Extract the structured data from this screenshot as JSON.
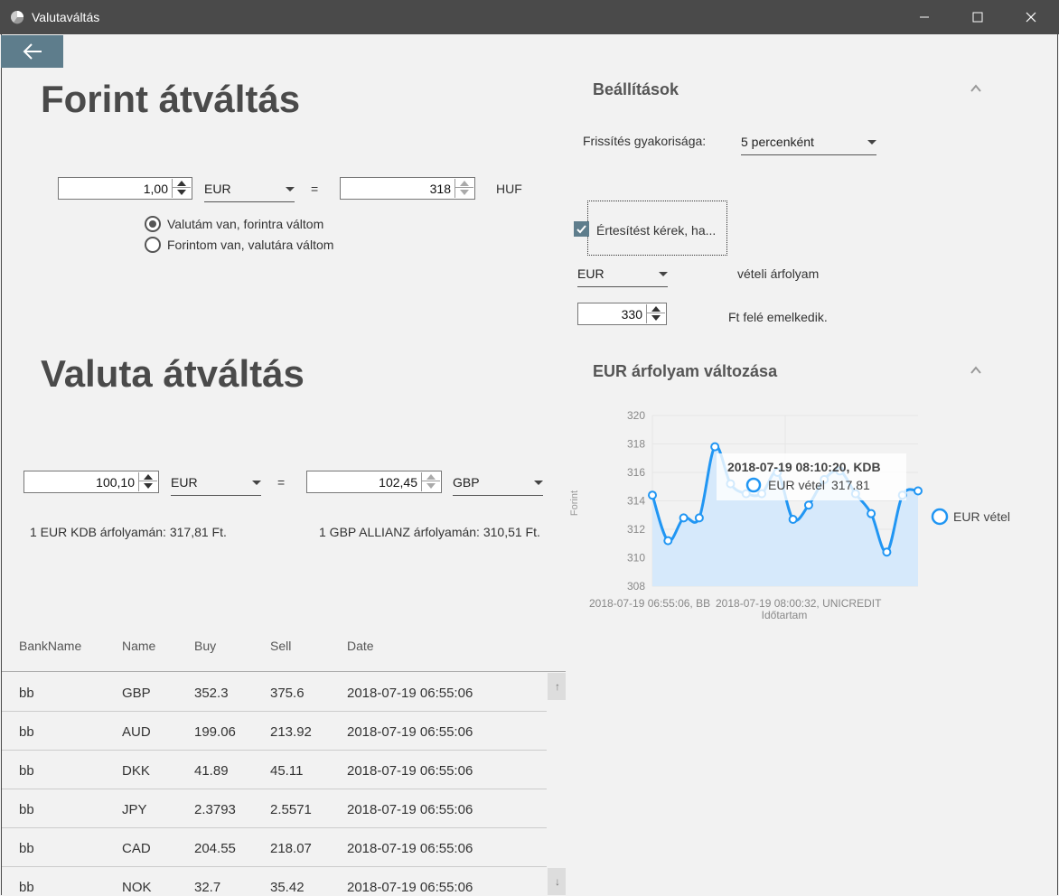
{
  "window": {
    "title": "Valutaváltás"
  },
  "forint": {
    "heading": "Forint átváltás",
    "amount": "1,00",
    "currency": "EUR",
    "equals": "=",
    "result": "318",
    "target_currency": "HUF",
    "radio_options": [
      "Valutám van, forintra váltom",
      "Forintom van, valutára váltom"
    ],
    "selected_index": 0
  },
  "settings": {
    "heading": "Beállítások",
    "refresh_label": "Frissítés gyakorisága:",
    "refresh_value": "5 percenként",
    "notify_label": "Értesítést kérek, ha...",
    "notify_checked": true,
    "notify_currency": "EUR",
    "notify_rate_label": "vételi árfolyam",
    "notify_threshold": "330",
    "notify_direction_label": "Ft felé emelkedik."
  },
  "valuta": {
    "heading": "Valuta átváltás",
    "amount": "100,10",
    "from_currency": "EUR",
    "equals": "=",
    "result": "102,45",
    "to_currency": "GBP",
    "from_rate_text": "1 EUR  KDB árfolyamán: 317,81 Ft.",
    "to_rate_text": "1 GBP  ALLIANZ árfolyamán: 310,51 Ft."
  },
  "table": {
    "columns": [
      "BankName",
      "Name",
      "Buy",
      "Sell",
      "Date"
    ],
    "rows": [
      [
        "bb",
        "GBP",
        "352.3",
        "375.6",
        "2018-07-19 06:55:06"
      ],
      [
        "bb",
        "AUD",
        "199.06",
        "213.92",
        "2018-07-19 06:55:06"
      ],
      [
        "bb",
        "DKK",
        "41.89",
        "45.11",
        "2018-07-19 06:55:06"
      ],
      [
        "bb",
        "JPY",
        "2.3793",
        "2.5571",
        "2018-07-19 06:55:06"
      ],
      [
        "bb",
        "CAD",
        "204.55",
        "218.07",
        "2018-07-19 06:55:06"
      ],
      [
        "bb",
        "NOK",
        "32.7",
        "35.42",
        "2018-07-19 06:55:06"
      ]
    ]
  },
  "chart_section": {
    "heading": "EUR árfolyam változása"
  },
  "chart_data": {
    "type": "area",
    "ylabel": "Forint",
    "xlabel": "Időtartam",
    "ylim": [
      308,
      320
    ],
    "yticks": [
      "308",
      "310",
      "312",
      "314",
      "316",
      "318",
      "320"
    ],
    "x_tick_labels": [
      "2018-07-19 06:55:06, BB",
      "2018-07-19 08:00:32, UNICREDIT"
    ],
    "series": [
      {
        "name": "EUR vétel",
        "color": "#2196f3",
        "values": [
          314.4,
          311.2,
          312.8,
          312.8,
          317.8,
          315.2,
          314.5,
          314.5,
          316.0,
          312.7,
          313.7,
          315.5,
          316.1,
          314.5,
          313.1,
          310.4,
          314.4,
          314.7
        ]
      }
    ],
    "legend": "right",
    "tooltip": {
      "title": "2018-07-19 08:10:20, KDB",
      "series": "EUR vétel",
      "value": "317.81"
    }
  },
  "colors": {
    "accent": "#5e7d8c",
    "chart_line": "#2196f3",
    "chart_fill": "#d6e9fb"
  }
}
